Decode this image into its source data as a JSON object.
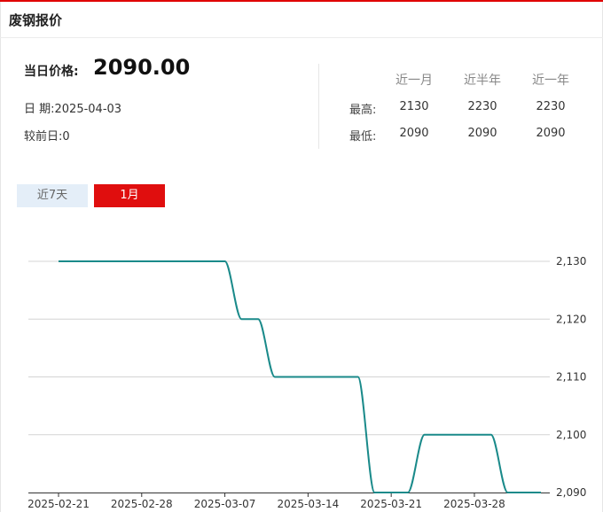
{
  "header": {
    "title": "废钢报价"
  },
  "summary": {
    "price_label": "当日价格:",
    "price_value": "2090.00",
    "date_line": "日 期:2025-04-03",
    "change_line": "较前日:0"
  },
  "stats": {
    "periods": [
      "近一月",
      "近半年",
      "近一年"
    ],
    "high_label": "最高:",
    "low_label": "最低:",
    "high": [
      "2130",
      "2230",
      "2230"
    ],
    "low": [
      "2090",
      "2090",
      "2090"
    ]
  },
  "tabs": [
    {
      "label": "近7天",
      "active": false
    },
    {
      "label": "1月",
      "active": true
    }
  ],
  "chart_data": {
    "type": "line",
    "line_color": "#1a8a8a",
    "grid": true,
    "y_axis_position": "right",
    "ylim": [
      2090,
      2130
    ],
    "y_ticks": [
      2090,
      2100,
      2110,
      2120,
      2130
    ],
    "y_tick_labels": [
      "2,090",
      "2,100",
      "2,110",
      "2,120",
      "2,130"
    ],
    "x_tick_labels": [
      "2025-02-21",
      "2025-02-28",
      "2025-03-07",
      "2025-03-14",
      "2025-03-21",
      "2025-03-28"
    ],
    "x_tick_index": [
      0,
      5,
      10,
      15,
      20,
      25
    ],
    "points": [
      {
        "x": "2025-02-21",
        "y": 2130
      },
      {
        "x": "2025-02-24",
        "y": 2130
      },
      {
        "x": "2025-02-25",
        "y": 2130
      },
      {
        "x": "2025-02-26",
        "y": 2130
      },
      {
        "x": "2025-02-27",
        "y": 2130
      },
      {
        "x": "2025-02-28",
        "y": 2130
      },
      {
        "x": "2025-03-03",
        "y": 2130
      },
      {
        "x": "2025-03-04",
        "y": 2130
      },
      {
        "x": "2025-03-05",
        "y": 2130
      },
      {
        "x": "2025-03-06",
        "y": 2130
      },
      {
        "x": "2025-03-07",
        "y": 2130
      },
      {
        "x": "2025-03-10",
        "y": 2120
      },
      {
        "x": "2025-03-11",
        "y": 2120
      },
      {
        "x": "2025-03-12",
        "y": 2110
      },
      {
        "x": "2025-03-13",
        "y": 2110
      },
      {
        "x": "2025-03-14",
        "y": 2110
      },
      {
        "x": "2025-03-17",
        "y": 2110
      },
      {
        "x": "2025-03-18",
        "y": 2110
      },
      {
        "x": "2025-03-19",
        "y": 2110
      },
      {
        "x": "2025-03-20",
        "y": 2090
      },
      {
        "x": "2025-03-21",
        "y": 2090
      },
      {
        "x": "2025-03-24",
        "y": 2090
      },
      {
        "x": "2025-03-25",
        "y": 2100
      },
      {
        "x": "2025-03-26",
        "y": 2100
      },
      {
        "x": "2025-03-27",
        "y": 2100
      },
      {
        "x": "2025-03-28",
        "y": 2100
      },
      {
        "x": "2025-03-31",
        "y": 2100
      },
      {
        "x": "2025-04-01",
        "y": 2090
      },
      {
        "x": "2025-04-02",
        "y": 2090
      },
      {
        "x": "2025-04-03",
        "y": 2090
      }
    ]
  }
}
